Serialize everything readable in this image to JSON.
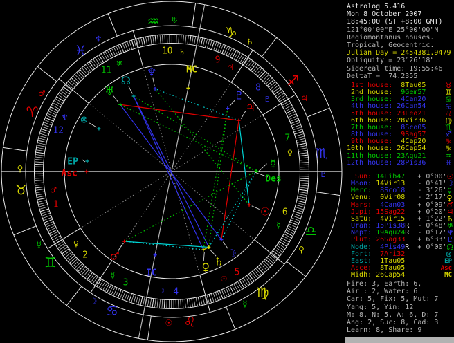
{
  "app_title": "Astrolog 5.416",
  "palette": {
    "red": "#e00000",
    "yellow": "#d6d600",
    "green": "#00c400",
    "blue": "#3333ee",
    "cyan": "#00d2d2",
    "teal": "#00a2a2",
    "white": "#e8e8e8",
    "gray": "#b4b4b4",
    "dgray": "#8a8a8a",
    "wheel_line": "#e8e8e8",
    "tick": "#d6d6d6",
    "pointer": "#d8d8d8"
  },
  "panel": {
    "header": [
      {
        "text": "Astrolog 5.416",
        "color": "white"
      },
      {
        "text": "Mon 8 October 2007",
        "color": "white"
      },
      {
        "text": "18:45:00 (ST +8:00 GMT)",
        "color": "white"
      },
      {
        "text": "121°00'00\"E 25°00'00\"N",
        "color": "gray"
      },
      {
        "text": "Regiomontanus houses.",
        "color": "gray"
      },
      {
        "text": "Tropical, Geocentric.",
        "color": "gray"
      },
      {
        "text": "Julian Day = 2454381.9479",
        "color": "yellow"
      },
      {
        "text": "Obliquity = 23°26'18\"",
        "color": "gray"
      },
      {
        "text": "Sidereal time: 19:55:46",
        "color": "gray"
      },
      {
        "text": "DeltaT =  74.2355",
        "color": "gray"
      }
    ],
    "house_word": " house:",
    "houses": [
      {
        "ord": " 1st",
        "lc": "red",
        "value": " 8Tau05",
        "vc": "yellow",
        "glyph": "♉",
        "gc": "red"
      },
      {
        "ord": " 2nd",
        "lc": "yellow",
        "value": " 9Gem57",
        "vc": "green",
        "glyph": "♊",
        "gc": "yellow"
      },
      {
        "ord": " 3rd",
        "lc": "green",
        "value": " 4Can20",
        "vc": "blue",
        "glyph": "♋",
        "gc": "green"
      },
      {
        "ord": " 4th",
        "lc": "blue",
        "value": "26Can54",
        "vc": "blue",
        "glyph": "♋",
        "gc": "blue"
      },
      {
        "ord": " 5th",
        "lc": "red",
        "value": "23Leo21",
        "vc": "red",
        "glyph": "♌",
        "gc": "red"
      },
      {
        "ord": " 6th",
        "lc": "yellow",
        "value": "28Vir36",
        "vc": "yellow",
        "glyph": "♍",
        "gc": "yellow"
      },
      {
        "ord": " 7th",
        "lc": "green",
        "value": " 8Sco05",
        "vc": "blue",
        "glyph": "♏",
        "gc": "green"
      },
      {
        "ord": " 8th",
        "lc": "blue",
        "value": " 9Sag57",
        "vc": "red",
        "glyph": "♐",
        "gc": "blue"
      },
      {
        "ord": " 9th",
        "lc": "red",
        "value": " 4Cap20",
        "vc": "yellow",
        "glyph": "♑",
        "gc": "red"
      },
      {
        "ord": "10th",
        "lc": "yellow",
        "value": "26Cap54",
        "vc": "yellow",
        "glyph": "♑",
        "gc": "yellow"
      },
      {
        "ord": "11th",
        "lc": "green",
        "value": "23Aqu21",
        "vc": "green",
        "glyph": "♒",
        "gc": "green"
      },
      {
        "ord": "12th",
        "lc": "blue",
        "value": "28Pis36",
        "vc": "blue",
        "glyph": "♓",
        "gc": "blue"
      }
    ],
    "planets": [
      {
        "label": "  Sun:",
        "lc": "red",
        "value": " 14Lib47",
        "vc": "green",
        "retro": " ",
        "delta": "+ 0°00'",
        "glyph": "☉",
        "gc": "red"
      },
      {
        "label": " Moon:",
        "lc": "blue",
        "value": " 14Vir13",
        "vc": "yellow",
        "retro": " ",
        "delta": "- 0°41'",
        "glyph": "☽",
        "gc": "blue"
      },
      {
        "label": " Merc:",
        "lc": "green",
        "value": "  8Sco18",
        "vc": "blue",
        "retro": " ",
        "delta": "- 3°26'",
        "glyph": "☿",
        "gc": "green"
      },
      {
        "label": " Venu:",
        "lc": "yellow",
        "value": "  0Vir08",
        "vc": "yellow",
        "retro": " ",
        "delta": "- 2°17'",
        "glyph": "♀",
        "gc": "yellow"
      },
      {
        "label": " Mars:",
        "lc": "red",
        "value": "  4Can03",
        "vc": "blue",
        "retro": " ",
        "delta": "+ 0°09'",
        "glyph": "♂",
        "gc": "red"
      },
      {
        "label": " Jupi:",
        "lc": "red",
        "value": " 15Sag22",
        "vc": "red",
        "retro": " ",
        "delta": "+ 0°20'",
        "glyph": "♃",
        "gc": "red"
      },
      {
        "label": " Satu:",
        "lc": "yellow",
        "value": "  4Vir15",
        "vc": "yellow",
        "retro": " ",
        "delta": "+ 1°22'",
        "glyph": "♄",
        "gc": "yellow"
      },
      {
        "label": " Uran:",
        "lc": "blue",
        "value": " 15Pis38",
        "vc": "blue",
        "retro": "R",
        "delta": "- 0°48'",
        "glyph": "♅",
        "gc": "green"
      },
      {
        "label": " Nept:",
        "lc": "blue",
        "value": " 19Aqu24",
        "vc": "green",
        "retro": "R",
        "delta": "- 0°17'",
        "glyph": "♆",
        "gc": "blue"
      },
      {
        "label": " Plut:",
        "lc": "red",
        "value": " 26Sag33",
        "vc": "red",
        "retro": " ",
        "delta": "+ 6°33'",
        "glyph": "♇",
        "gc": "blue"
      },
      {
        "label": " Node:",
        "lc": "teal",
        "value": "  4Pis49",
        "vc": "blue",
        "retro": "R",
        "delta": "+ 0°00'",
        "glyph": "☊",
        "gc": "green"
      },
      {
        "label": " Fort:",
        "lc": "teal",
        "value": "  7Ari32",
        "vc": "red",
        "retro": "",
        "delta": "",
        "glyph": "⊗",
        "gc": "teal"
      },
      {
        "label": " East:",
        "lc": "teal",
        "value": "  1Tau05",
        "vc": "yellow",
        "retro": "",
        "delta": "",
        "glyph": "EP",
        "gc": "teal",
        "gm": true
      },
      {
        "label": " Asce:",
        "lc": "red",
        "value": "  8Tau05",
        "vc": "yellow",
        "retro": "",
        "delta": "",
        "glyph": "Asc",
        "gc": "red",
        "gm": true
      },
      {
        "label": " Midh:",
        "lc": "yellow",
        "value": " 26Cap54",
        "vc": "yellow",
        "retro": "",
        "delta": "",
        "glyph": "MC",
        "gc": "yellow",
        "gm": true
      }
    ],
    "summary": [
      "Fire: 3, Earth: 6,",
      "Air : 2, Water: 6",
      "Car: 5, Fix: 5, Mut: 7",
      "Yang: 5, Yin: 12",
      "M: 8, N: 5, A: 6, D: 7",
      "Ang: 2, Suc: 8, Cad: 3",
      "Learn: 8, Share: 9"
    ]
  },
  "wheel": {
    "ascendant": 38.083,
    "sign_ring": [
      {
        "name": "aries",
        "glyph": "♈",
        "color": "red",
        "ruler": "♂",
        "ruler_color": "red"
      },
      {
        "name": "taurus",
        "glyph": "♉",
        "color": "yellow",
        "ruler": "♀",
        "ruler_color": "yellow"
      },
      {
        "name": "gemini",
        "glyph": "♊",
        "color": "green",
        "ruler": "☿",
        "ruler_color": "green"
      },
      {
        "name": "cancer",
        "glyph": "♋",
        "color": "blue",
        "ruler": "☽",
        "ruler_color": "blue"
      },
      {
        "name": "leo",
        "glyph": "♌",
        "color": "red",
        "ruler": "☉",
        "ruler_color": "red"
      },
      {
        "name": "virgo",
        "glyph": "♍",
        "color": "yellow",
        "ruler": "☿",
        "ruler_color": "green"
      },
      {
        "name": "libra",
        "glyph": "♎",
        "color": "green",
        "ruler": "♀",
        "ruler_color": "yellow"
      },
      {
        "name": "scorpio",
        "glyph": "♏",
        "color": "blue",
        "ruler": "♇",
        "ruler_color": "blue"
      },
      {
        "name": "sagittarius",
        "glyph": "♐",
        "color": "red",
        "ruler": "♃",
        "ruler_color": "red"
      },
      {
        "name": "capricorn",
        "glyph": "♑",
        "color": "yellow",
        "ruler": "♄",
        "ruler_color": "yellow"
      },
      {
        "name": "aquarius",
        "glyph": "♒",
        "color": "green",
        "ruler": "♅",
        "ruler_color": "green"
      },
      {
        "name": "pisces",
        "glyph": "♓",
        "color": "blue",
        "ruler": "♆",
        "ruler_color": "blue"
      }
    ],
    "house_cusps": [
      38.083,
      69.95,
      94.333,
      116.9,
      143.35,
      178.6,
      218.083,
      249.95,
      274.333,
      296.9,
      323.35,
      358.6
    ],
    "house_colors": [
      "red",
      "yellow",
      "green",
      "blue",
      "red",
      "yellow",
      "green",
      "blue",
      "red",
      "yellow",
      "green",
      "blue"
    ],
    "house_rulers": [
      {
        "glyph": "♂",
        "color": "red"
      },
      {
        "glyph": "♀",
        "color": "yellow"
      },
      {
        "glyph": "☿",
        "color": "green"
      },
      {
        "glyph": "☽",
        "color": "blue"
      },
      {
        "glyph": "☉",
        "color": "red"
      },
      {
        "glyph": "☿",
        "color": "green"
      },
      {
        "glyph": "♀",
        "color": "yellow"
      },
      {
        "glyph": "♇",
        "color": "blue"
      },
      {
        "glyph": "♃",
        "color": "red"
      },
      {
        "glyph": "♄",
        "color": "yellow"
      },
      {
        "glyph": "♅",
        "color": "green"
      },
      {
        "glyph": "♆",
        "color": "blue"
      }
    ],
    "planets": [
      {
        "name": "sun",
        "glyph": "☉",
        "color": "red",
        "lon": 194.783
      },
      {
        "name": "moon",
        "glyph": "☽",
        "color": "blue",
        "lon": 164.217
      },
      {
        "name": "mercury",
        "glyph": "☿",
        "color": "green",
        "lon": 218.3,
        "dth": 4.5
      },
      {
        "name": "venus",
        "glyph": "♀",
        "color": "yellow",
        "lon": 150.133,
        "dth": -2.5
      },
      {
        "name": "mars",
        "glyph": "♂",
        "color": "red",
        "lon": 94.05
      },
      {
        "name": "jupiter",
        "glyph": "♃",
        "color": "red",
        "lon": 255.367,
        "dth": 2
      },
      {
        "name": "saturn",
        "glyph": "♄",
        "color": "yellow",
        "lon": 154.25,
        "dth": 1.5
      },
      {
        "name": "uranus",
        "glyph": "♅",
        "color": "green",
        "lon": 345.633
      },
      {
        "name": "neptune",
        "glyph": "♆",
        "color": "blue",
        "lon": 319.4
      },
      {
        "name": "pluto",
        "glyph": "♇",
        "color": "blue",
        "lon": 266.55
      },
      {
        "name": "node",
        "glyph": "☊",
        "color": "teal",
        "lon": 334.817
      },
      {
        "name": "fortune",
        "glyph": "⊗",
        "color": "teal",
        "lon": 7.533
      }
    ],
    "points": [
      {
        "name": "mc",
        "label": "MC",
        "color": "yellow",
        "lon": 296.9
      },
      {
        "name": "ic",
        "label": "IC",
        "color": "blue",
        "lon": 116.9
      },
      {
        "name": "des",
        "label": "Des",
        "color": "green",
        "lon": 218.083
      },
      {
        "name": "asc",
        "label": "Asc",
        "color": "red",
        "lon": 38.083
      },
      {
        "name": "ep",
        "label": "EP",
        "color": "teal",
        "lon": 31.083
      }
    ],
    "aspects": [
      {
        "a": "moon",
        "b": "uranus",
        "color": "blue",
        "dotted": false
      },
      {
        "a": "venus",
        "b": "node",
        "color": "blue",
        "dotted": false
      },
      {
        "a": "saturn",
        "b": "node",
        "color": "blue",
        "dotted": false
      },
      {
        "a": "moon",
        "b": "jupiter",
        "color": "red",
        "dotted": false
      },
      {
        "a": "jupiter",
        "b": "uranus",
        "color": "red",
        "dotted": false
      },
      {
        "a": "sun",
        "b": "neptune",
        "color": "green",
        "dotted": true
      },
      {
        "a": "mercury",
        "b": "mars",
        "color": "green",
        "dotted": true
      },
      {
        "a": "venus",
        "b": "pluto",
        "color": "green",
        "dotted": true
      },
      {
        "a": "mercury",
        "b": "node",
        "color": "green",
        "dotted": true
      },
      {
        "a": "mercury",
        "b": "uranus",
        "color": "green",
        "dotted": true
      },
      {
        "a": "saturn",
        "b": "pluto",
        "color": "green",
        "dotted": true
      },
      {
        "a": "sun",
        "b": "jupiter",
        "color": "cyan",
        "dotted": false
      },
      {
        "a": "mars",
        "b": "saturn",
        "color": "cyan",
        "dotted": false
      },
      {
        "a": "venus",
        "b": "mars",
        "color": "cyan",
        "dotted": true
      },
      {
        "a": "moon",
        "b": "mercury",
        "color": "cyan",
        "dotted": true
      },
      {
        "a": "saturn",
        "b": "mercury",
        "color": "cyan",
        "dotted": true
      },
      {
        "a": "jupiter",
        "b": "neptune",
        "color": "cyan",
        "dotted": true
      },
      {
        "a": "venus",
        "b": "saturn",
        "color": "yellow",
        "dotted": false
      }
    ]
  }
}
